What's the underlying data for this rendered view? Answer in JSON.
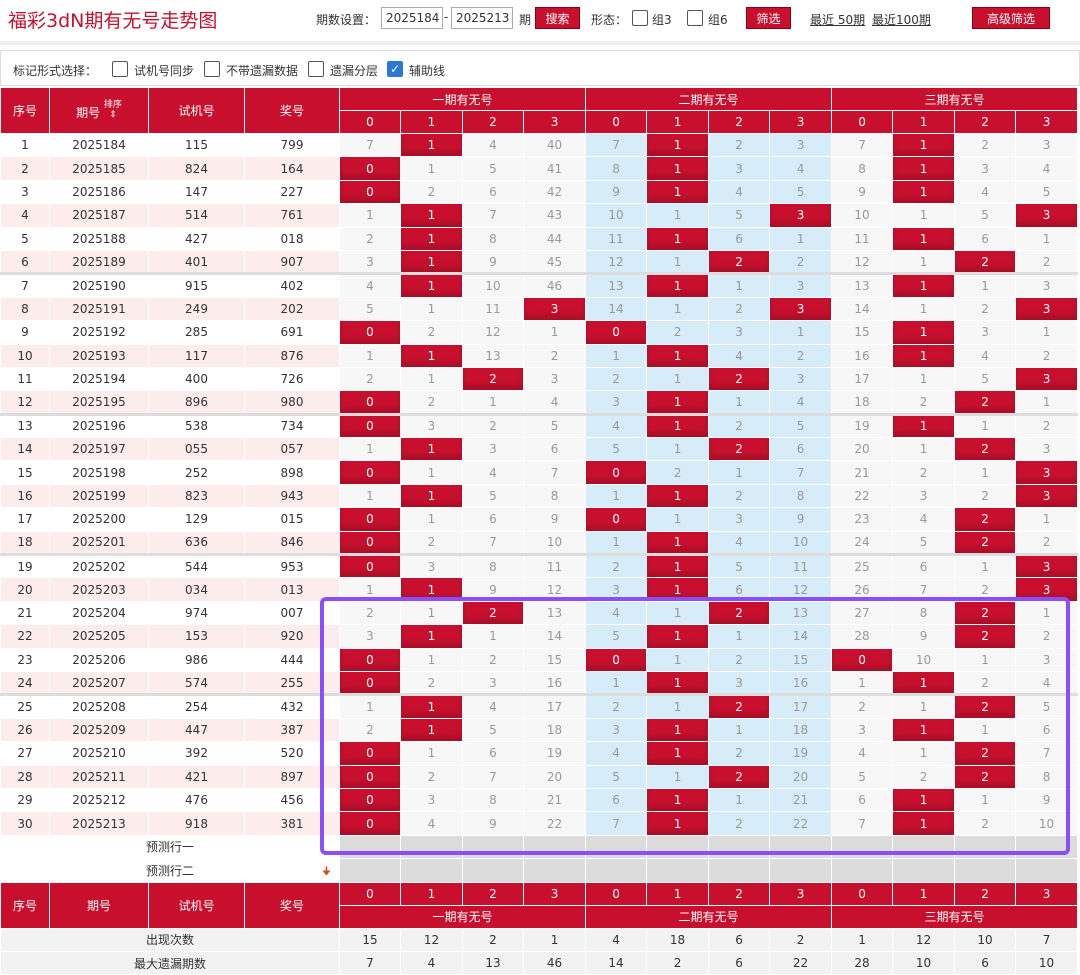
{
  "header": {
    "title": "福彩3dN期有无号走势图",
    "period_label": "期数设置：",
    "start_value": "2025184",
    "dash": "-",
    "end_value": "2025213",
    "qi": "期",
    "search_label": "搜索",
    "form_label": "形态：",
    "zu3_label": "组3",
    "zu6_label": "组6",
    "filter_label": "筛选",
    "recent50": "最近 50期",
    "recent100": "最近100期",
    "advanced_label": "高级筛选"
  },
  "options": {
    "label": "标记形式选择：",
    "items": [
      {
        "label": "试机号同步",
        "checked": false
      },
      {
        "label": "不带遗漏数据",
        "checked": false
      },
      {
        "label": "遗漏分层",
        "checked": false
      },
      {
        "label": "辅助线",
        "checked": true
      }
    ]
  },
  "columns": {
    "seq": "序号",
    "period": "期号",
    "sort": "排序",
    "trial": "试机号",
    "prize": "奖号",
    "g1": "一期有无号",
    "g2": "二期有无号",
    "g3": "三期有无号",
    "sub": [
      "0",
      "1",
      "2",
      "3",
      "0",
      "1",
      "2",
      "3",
      "0",
      "1",
      "2",
      "3"
    ]
  },
  "rows": [
    {
      "seq": "1",
      "period": "2025184",
      "trial": "115",
      "prize": "799",
      "v": [
        "7",
        "1",
        "4",
        "40",
        "7",
        "1",
        "2",
        "3",
        "7",
        "1",
        "2",
        "3"
      ],
      "h": [
        0,
        1,
        0,
        0,
        0,
        1,
        0,
        0,
        0,
        1,
        0,
        0
      ]
    },
    {
      "seq": "2",
      "period": "2025185",
      "trial": "824",
      "prize": "164",
      "v": [
        "0",
        "1",
        "5",
        "41",
        "8",
        "1",
        "3",
        "4",
        "8",
        "1",
        "3",
        "4"
      ],
      "h": [
        1,
        0,
        0,
        0,
        0,
        1,
        0,
        0,
        0,
        1,
        0,
        0
      ]
    },
    {
      "seq": "3",
      "period": "2025186",
      "trial": "147",
      "prize": "227",
      "v": [
        "0",
        "2",
        "6",
        "42",
        "9",
        "1",
        "4",
        "5",
        "9",
        "1",
        "4",
        "5"
      ],
      "h": [
        1,
        0,
        0,
        0,
        0,
        1,
        0,
        0,
        0,
        1,
        0,
        0
      ]
    },
    {
      "seq": "4",
      "period": "2025187",
      "trial": "514",
      "prize": "761",
      "v": [
        "1",
        "1",
        "7",
        "43",
        "10",
        "1",
        "5",
        "3",
        "10",
        "1",
        "5",
        "3"
      ],
      "h": [
        0,
        1,
        0,
        0,
        0,
        0,
        0,
        1,
        0,
        0,
        0,
        1
      ]
    },
    {
      "seq": "5",
      "period": "2025188",
      "trial": "427",
      "prize": "018",
      "v": [
        "2",
        "1",
        "8",
        "44",
        "11",
        "1",
        "6",
        "1",
        "11",
        "1",
        "6",
        "1"
      ],
      "h": [
        0,
        1,
        0,
        0,
        0,
        1,
        0,
        0,
        0,
        1,
        0,
        0
      ]
    },
    {
      "seq": "6",
      "period": "2025189",
      "trial": "401",
      "prize": "907",
      "v": [
        "3",
        "1",
        "9",
        "45",
        "12",
        "1",
        "2",
        "2",
        "12",
        "1",
        "2",
        "2"
      ],
      "h": [
        0,
        1,
        0,
        0,
        0,
        0,
        1,
        0,
        0,
        0,
        1,
        0
      ]
    },
    {
      "seq": "7",
      "period": "2025190",
      "trial": "915",
      "prize": "402",
      "v": [
        "4",
        "1",
        "10",
        "46",
        "13",
        "1",
        "1",
        "3",
        "13",
        "1",
        "1",
        "3"
      ],
      "h": [
        0,
        1,
        0,
        0,
        0,
        1,
        0,
        0,
        0,
        1,
        0,
        0
      ]
    },
    {
      "seq": "8",
      "period": "2025191",
      "trial": "249",
      "prize": "202",
      "v": [
        "5",
        "1",
        "11",
        "3",
        "14",
        "1",
        "2",
        "3",
        "14",
        "1",
        "2",
        "3"
      ],
      "h": [
        0,
        0,
        0,
        1,
        0,
        0,
        0,
        1,
        0,
        0,
        0,
        1
      ]
    },
    {
      "seq": "9",
      "period": "2025192",
      "trial": "285",
      "prize": "691",
      "v": [
        "0",
        "2",
        "12",
        "1",
        "0",
        "2",
        "3",
        "1",
        "15",
        "1",
        "3",
        "1"
      ],
      "h": [
        1,
        0,
        0,
        0,
        1,
        0,
        0,
        0,
        0,
        1,
        0,
        0
      ]
    },
    {
      "seq": "10",
      "period": "2025193",
      "trial": "117",
      "prize": "876",
      "v": [
        "1",
        "1",
        "13",
        "2",
        "1",
        "1",
        "4",
        "2",
        "16",
        "1",
        "4",
        "2"
      ],
      "h": [
        0,
        1,
        0,
        0,
        0,
        1,
        0,
        0,
        0,
        1,
        0,
        0
      ]
    },
    {
      "seq": "11",
      "period": "2025194",
      "trial": "400",
      "prize": "726",
      "v": [
        "2",
        "1",
        "2",
        "3",
        "2",
        "1",
        "2",
        "3",
        "17",
        "1",
        "5",
        "3"
      ],
      "h": [
        0,
        0,
        1,
        0,
        0,
        0,
        1,
        0,
        0,
        0,
        0,
        1
      ]
    },
    {
      "seq": "12",
      "period": "2025195",
      "trial": "896",
      "prize": "980",
      "v": [
        "0",
        "2",
        "1",
        "4",
        "3",
        "1",
        "1",
        "4",
        "18",
        "2",
        "2",
        "1"
      ],
      "h": [
        1,
        0,
        0,
        0,
        0,
        1,
        0,
        0,
        0,
        0,
        1,
        0
      ]
    },
    {
      "seq": "13",
      "period": "2025196",
      "trial": "538",
      "prize": "734",
      "v": [
        "0",
        "3",
        "2",
        "5",
        "4",
        "1",
        "2",
        "5",
        "19",
        "1",
        "1",
        "2"
      ],
      "h": [
        1,
        0,
        0,
        0,
        0,
        1,
        0,
        0,
        0,
        1,
        0,
        0
      ]
    },
    {
      "seq": "14",
      "period": "2025197",
      "trial": "055",
      "prize": "057",
      "v": [
        "1",
        "1",
        "3",
        "6",
        "5",
        "1",
        "2",
        "6",
        "20",
        "1",
        "2",
        "3"
      ],
      "h": [
        0,
        1,
        0,
        0,
        0,
        0,
        1,
        0,
        0,
        0,
        1,
        0
      ]
    },
    {
      "seq": "15",
      "period": "2025198",
      "trial": "252",
      "prize": "898",
      "v": [
        "0",
        "1",
        "4",
        "7",
        "0",
        "2",
        "1",
        "7",
        "21",
        "2",
        "1",
        "3"
      ],
      "h": [
        1,
        0,
        0,
        0,
        1,
        0,
        0,
        0,
        0,
        0,
        0,
        1
      ]
    },
    {
      "seq": "16",
      "period": "2025199",
      "trial": "823",
      "prize": "943",
      "v": [
        "1",
        "1",
        "5",
        "8",
        "1",
        "1",
        "2",
        "8",
        "22",
        "3",
        "2",
        "3"
      ],
      "h": [
        0,
        1,
        0,
        0,
        0,
        1,
        0,
        0,
        0,
        0,
        0,
        1
      ]
    },
    {
      "seq": "17",
      "period": "2025200",
      "trial": "129",
      "prize": "015",
      "v": [
        "0",
        "1",
        "6",
        "9",
        "0",
        "1",
        "3",
        "9",
        "23",
        "4",
        "2",
        "1"
      ],
      "h": [
        1,
        0,
        0,
        0,
        1,
        0,
        0,
        0,
        0,
        0,
        1,
        0
      ]
    },
    {
      "seq": "18",
      "period": "2025201",
      "trial": "636",
      "prize": "846",
      "v": [
        "0",
        "2",
        "7",
        "10",
        "1",
        "1",
        "4",
        "10",
        "24",
        "5",
        "2",
        "2"
      ],
      "h": [
        1,
        0,
        0,
        0,
        0,
        1,
        0,
        0,
        0,
        0,
        1,
        0
      ]
    },
    {
      "seq": "19",
      "period": "2025202",
      "trial": "544",
      "prize": "953",
      "v": [
        "0",
        "3",
        "8",
        "11",
        "2",
        "1",
        "5",
        "11",
        "25",
        "6",
        "1",
        "3"
      ],
      "h": [
        1,
        0,
        0,
        0,
        0,
        1,
        0,
        0,
        0,
        0,
        0,
        1
      ]
    },
    {
      "seq": "20",
      "period": "2025203",
      "trial": "034",
      "prize": "013",
      "v": [
        "1",
        "1",
        "9",
        "12",
        "3",
        "1",
        "6",
        "12",
        "26",
        "7",
        "2",
        "3"
      ],
      "h": [
        0,
        1,
        0,
        0,
        0,
        1,
        0,
        0,
        0,
        0,
        0,
        1
      ]
    },
    {
      "seq": "21",
      "period": "2025204",
      "trial": "974",
      "prize": "007",
      "v": [
        "2",
        "1",
        "2",
        "13",
        "4",
        "1",
        "2",
        "13",
        "27",
        "8",
        "2",
        "1"
      ],
      "h": [
        0,
        0,
        1,
        0,
        0,
        0,
        1,
        0,
        0,
        0,
        1,
        0
      ]
    },
    {
      "seq": "22",
      "period": "2025205",
      "trial": "153",
      "prize": "920",
      "v": [
        "3",
        "1",
        "1",
        "14",
        "5",
        "1",
        "1",
        "14",
        "28",
        "9",
        "2",
        "2"
      ],
      "h": [
        0,
        1,
        0,
        0,
        0,
        1,
        0,
        0,
        0,
        0,
        1,
        0
      ]
    },
    {
      "seq": "23",
      "period": "2025206",
      "trial": "986",
      "prize": "444",
      "v": [
        "0",
        "1",
        "2",
        "15",
        "0",
        "1",
        "2",
        "15",
        "0",
        "10",
        "1",
        "3"
      ],
      "h": [
        1,
        0,
        0,
        0,
        1,
        0,
        0,
        0,
        1,
        0,
        0,
        0
      ]
    },
    {
      "seq": "24",
      "period": "2025207",
      "trial": "574",
      "prize": "255",
      "v": [
        "0",
        "2",
        "3",
        "16",
        "1",
        "1",
        "3",
        "16",
        "1",
        "1",
        "2",
        "4"
      ],
      "h": [
        1,
        0,
        0,
        0,
        0,
        1,
        0,
        0,
        0,
        1,
        0,
        0
      ]
    },
    {
      "seq": "25",
      "period": "2025208",
      "trial": "254",
      "prize": "432",
      "v": [
        "1",
        "1",
        "4",
        "17",
        "2",
        "1",
        "2",
        "17",
        "2",
        "1",
        "2",
        "5"
      ],
      "h": [
        0,
        1,
        0,
        0,
        0,
        0,
        1,
        0,
        0,
        0,
        1,
        0
      ]
    },
    {
      "seq": "26",
      "period": "2025209",
      "trial": "447",
      "prize": "387",
      "v": [
        "2",
        "1",
        "5",
        "18",
        "3",
        "1",
        "1",
        "18",
        "3",
        "1",
        "1",
        "6"
      ],
      "h": [
        0,
        1,
        0,
        0,
        0,
        1,
        0,
        0,
        0,
        1,
        0,
        0
      ]
    },
    {
      "seq": "27",
      "period": "2025210",
      "trial": "392",
      "prize": "520",
      "v": [
        "0",
        "1",
        "6",
        "19",
        "4",
        "1",
        "2",
        "19",
        "4",
        "1",
        "2",
        "7"
      ],
      "h": [
        1,
        0,
        0,
        0,
        0,
        1,
        0,
        0,
        0,
        0,
        1,
        0
      ]
    },
    {
      "seq": "28",
      "period": "2025211",
      "trial": "421",
      "prize": "897",
      "v": [
        "0",
        "2",
        "7",
        "20",
        "5",
        "1",
        "2",
        "20",
        "5",
        "2",
        "2",
        "8"
      ],
      "h": [
        1,
        0,
        0,
        0,
        0,
        0,
        1,
        0,
        0,
        0,
        1,
        0
      ]
    },
    {
      "seq": "29",
      "period": "2025212",
      "trial": "476",
      "prize": "456",
      "v": [
        "0",
        "3",
        "8",
        "21",
        "6",
        "1",
        "1",
        "21",
        "6",
        "1",
        "1",
        "9"
      ],
      "h": [
        1,
        0,
        0,
        0,
        0,
        1,
        0,
        0,
        0,
        1,
        0,
        0
      ]
    },
    {
      "seq": "30",
      "period": "2025213",
      "trial": "918",
      "prize": "381",
      "v": [
        "0",
        "4",
        "9",
        "22",
        "7",
        "1",
        "2",
        "22",
        "7",
        "1",
        "2",
        "10"
      ],
      "h": [
        1,
        0,
        0,
        0,
        0,
        1,
        0,
        0,
        0,
        1,
        0,
        0
      ]
    }
  ],
  "predict": {
    "row1": "预测行一",
    "row2": "预测行二",
    "arrow": "🠋"
  },
  "stats": {
    "appear_label": "出现次数",
    "appear": [
      "15",
      "12",
      "2",
      "1",
      "4",
      "18",
      "6",
      "2",
      "1",
      "12",
      "10",
      "7"
    ],
    "maxmiss_label": "最大遗漏期数",
    "maxmiss": [
      "7",
      "4",
      "13",
      "46",
      "14",
      "2",
      "6",
      "22",
      "28",
      "10",
      "6",
      "10"
    ]
  }
}
